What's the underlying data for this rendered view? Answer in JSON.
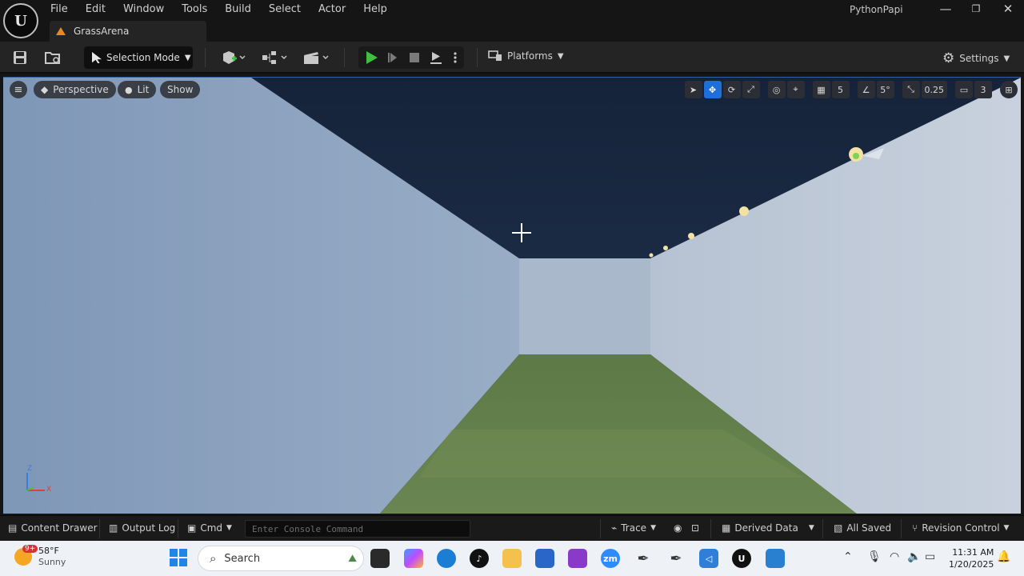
{
  "menubar": {
    "logo": "U",
    "items": [
      "File",
      "Edit",
      "Window",
      "Tools",
      "Build",
      "Select",
      "Actor",
      "Help"
    ],
    "project_name": "PythonPapi",
    "window_controls": [
      "—",
      "❐",
      "✕"
    ]
  },
  "level_tab": {
    "label": "GrassArena"
  },
  "toolbar": {
    "selection_mode": "Selection Mode",
    "platforms": "Platforms",
    "settings": "Settings"
  },
  "viewport": {
    "perspective": "Perspective",
    "lit": "Lit",
    "show": "Show",
    "grid_snap": "5",
    "rotation_snap": "5°",
    "scale_snap": "0.25",
    "camera_speed": "3",
    "axis_z": "Z",
    "axis_x": "X"
  },
  "statusbar": {
    "content_drawer": "Content Drawer",
    "output_log": "Output Log",
    "cmd": "Cmd",
    "console_placeholder": "Enter Console Command",
    "trace": "Trace",
    "derived_data": "Derived Data",
    "all_saved": "All Saved",
    "revision_control": "Revision Control"
  },
  "taskbar": {
    "weather_badge": "9+",
    "temperature": "58°F",
    "condition": "Sunny",
    "search": "Search",
    "time": "11:31 AM",
    "date": "1/20/2025"
  },
  "colors": {
    "accent": "#1e6fd9",
    "play": "#3fbf3f",
    "level_icon": "#e88a20"
  }
}
